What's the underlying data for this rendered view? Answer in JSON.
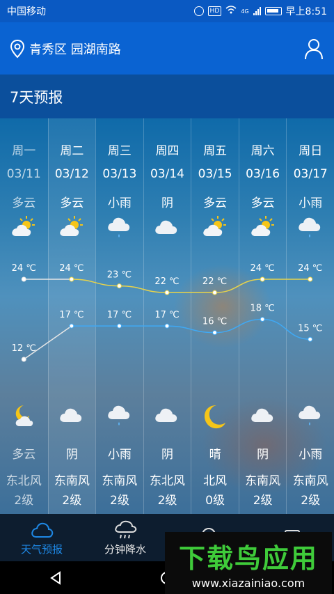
{
  "status_bar": {
    "carrier": "中国移动",
    "network": "4G",
    "hd": "HD",
    "time": "早上8:51"
  },
  "header": {
    "location": "青秀区 园湖南路"
  },
  "section_title": "7天预报",
  "days": [
    {
      "day": "周一",
      "date": "03/11",
      "cond": "多云",
      "day_icon": "partly-cloudy-icon",
      "high": "24 ℃",
      "low": "12 ℃",
      "night_icon": "moon-cloud-icon",
      "night_cond": "多云",
      "wind_dir": "东北风",
      "wind_lvl": "2级"
    },
    {
      "day": "周二",
      "date": "03/12",
      "cond": "多云",
      "day_icon": "partly-cloudy-icon",
      "high": "24 ℃",
      "low": "17 ℃",
      "night_icon": "cloud-icon",
      "night_cond": "阴",
      "wind_dir": "东南风",
      "wind_lvl": "2级"
    },
    {
      "day": "周三",
      "date": "03/13",
      "cond": "小雨",
      "day_icon": "rain-icon",
      "high": "23 ℃",
      "low": "17 ℃",
      "night_icon": "rain-icon",
      "night_cond": "小雨",
      "wind_dir": "东南风",
      "wind_lvl": "2级"
    },
    {
      "day": "周四",
      "date": "03/14",
      "cond": "阴",
      "day_icon": "cloud-icon",
      "high": "22 ℃",
      "low": "17 ℃",
      "night_icon": "cloud-icon",
      "night_cond": "阴",
      "wind_dir": "东北风",
      "wind_lvl": "2级"
    },
    {
      "day": "周五",
      "date": "03/15",
      "cond": "多云",
      "day_icon": "partly-cloudy-icon",
      "high": "22 ℃",
      "low": "16 ℃",
      "night_icon": "moon-icon",
      "night_cond": "晴",
      "wind_dir": "北风",
      "wind_lvl": "0级"
    },
    {
      "day": "周六",
      "date": "03/16",
      "cond": "多云",
      "day_icon": "partly-cloudy-icon",
      "high": "24 ℃",
      "low": "18 ℃",
      "night_icon": "cloud-icon",
      "night_cond": "阴",
      "wind_dir": "东南风",
      "wind_lvl": "2级"
    },
    {
      "day": "周日",
      "date": "03/17",
      "cond": "小雨",
      "day_icon": "rain-icon",
      "high": "24 ℃",
      "low": "15 ℃",
      "night_icon": "rain-icon",
      "night_cond": "小雨",
      "wind_dir": "东南风",
      "wind_lvl": "2级"
    }
  ],
  "chart_data": {
    "type": "line",
    "categories": [
      "03/11",
      "03/12",
      "03/13",
      "03/14",
      "03/15",
      "03/16",
      "03/17"
    ],
    "series": [
      {
        "values": [
          24,
          24,
          23,
          22,
          22,
          24,
          24
        ],
        "color": "#e8d34a"
      },
      {
        "values": [
          12,
          17,
          17,
          17,
          16,
          18,
          15
        ],
        "color": "#3fa9f5"
      }
    ],
    "past_color": "#e6e6e6"
  },
  "tabs": [
    {
      "label": "天气预报",
      "icon": "cloud-icon",
      "active": true
    },
    {
      "label": "分钟降水",
      "icon": "rain-cloud-icon",
      "active": false
    },
    {
      "label": "",
      "icon": "location-pin-icon",
      "active": false
    },
    {
      "label": "",
      "icon": "box-icon",
      "active": false
    }
  ],
  "watermark": {
    "title": "下载鸟应用",
    "url": "www.xiazainiao.com"
  },
  "colors": {
    "header": "#0a63d2",
    "status": "#0a59c2",
    "section": "#0b4f9c",
    "tab_active": "#1e88e5"
  }
}
